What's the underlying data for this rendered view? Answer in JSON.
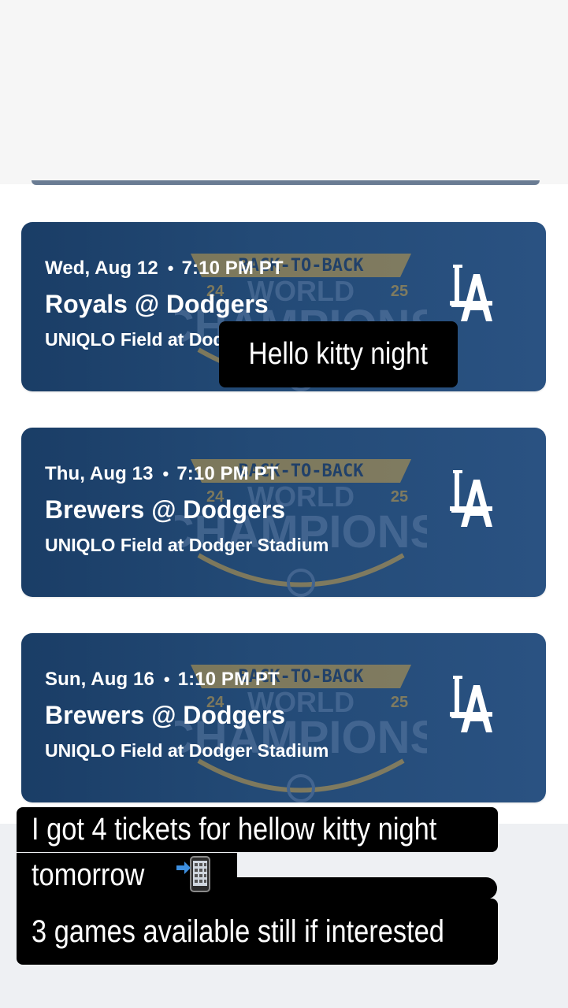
{
  "games": [
    {
      "date": "Wed, Aug 12",
      "time": "7:10 PM PT",
      "matchup": "Royals @ Dodgers",
      "venue": "UNIQLO Field at Dodger Stadium",
      "logo": "la-dodgers-logo"
    },
    {
      "date": "Thu, Aug 13",
      "time": "7:10 PM PT",
      "matchup": "Brewers @ Dodgers",
      "venue": "UNIQLO Field at Dodger Stadium",
      "logo": "la-dodgers-logo"
    },
    {
      "date": "Sun, Aug 16",
      "time": "1:10 PM PT",
      "matchup": "Brewers @ Dodgers",
      "venue": "UNIQLO Field at Dodger Stadium",
      "logo": "la-dodgers-logo"
    }
  ],
  "watermark": {
    "top": "BACK-TO-BACK",
    "middle": "WORLD",
    "bottom": "CHAMPIONS",
    "year_left": "24",
    "year_right": "25"
  },
  "captions": {
    "kitty": "Hello kitty night",
    "line1": "I got 4 tickets for hellow kitty night",
    "line2": "tomorrow",
    "line2_emoji": "phone-with-arrow-icon",
    "line3": "3 games available still if interested"
  },
  "colors": {
    "card": "#1f4470",
    "caption_bg": "#000000",
    "watermark_gold": "#c9a04a"
  }
}
